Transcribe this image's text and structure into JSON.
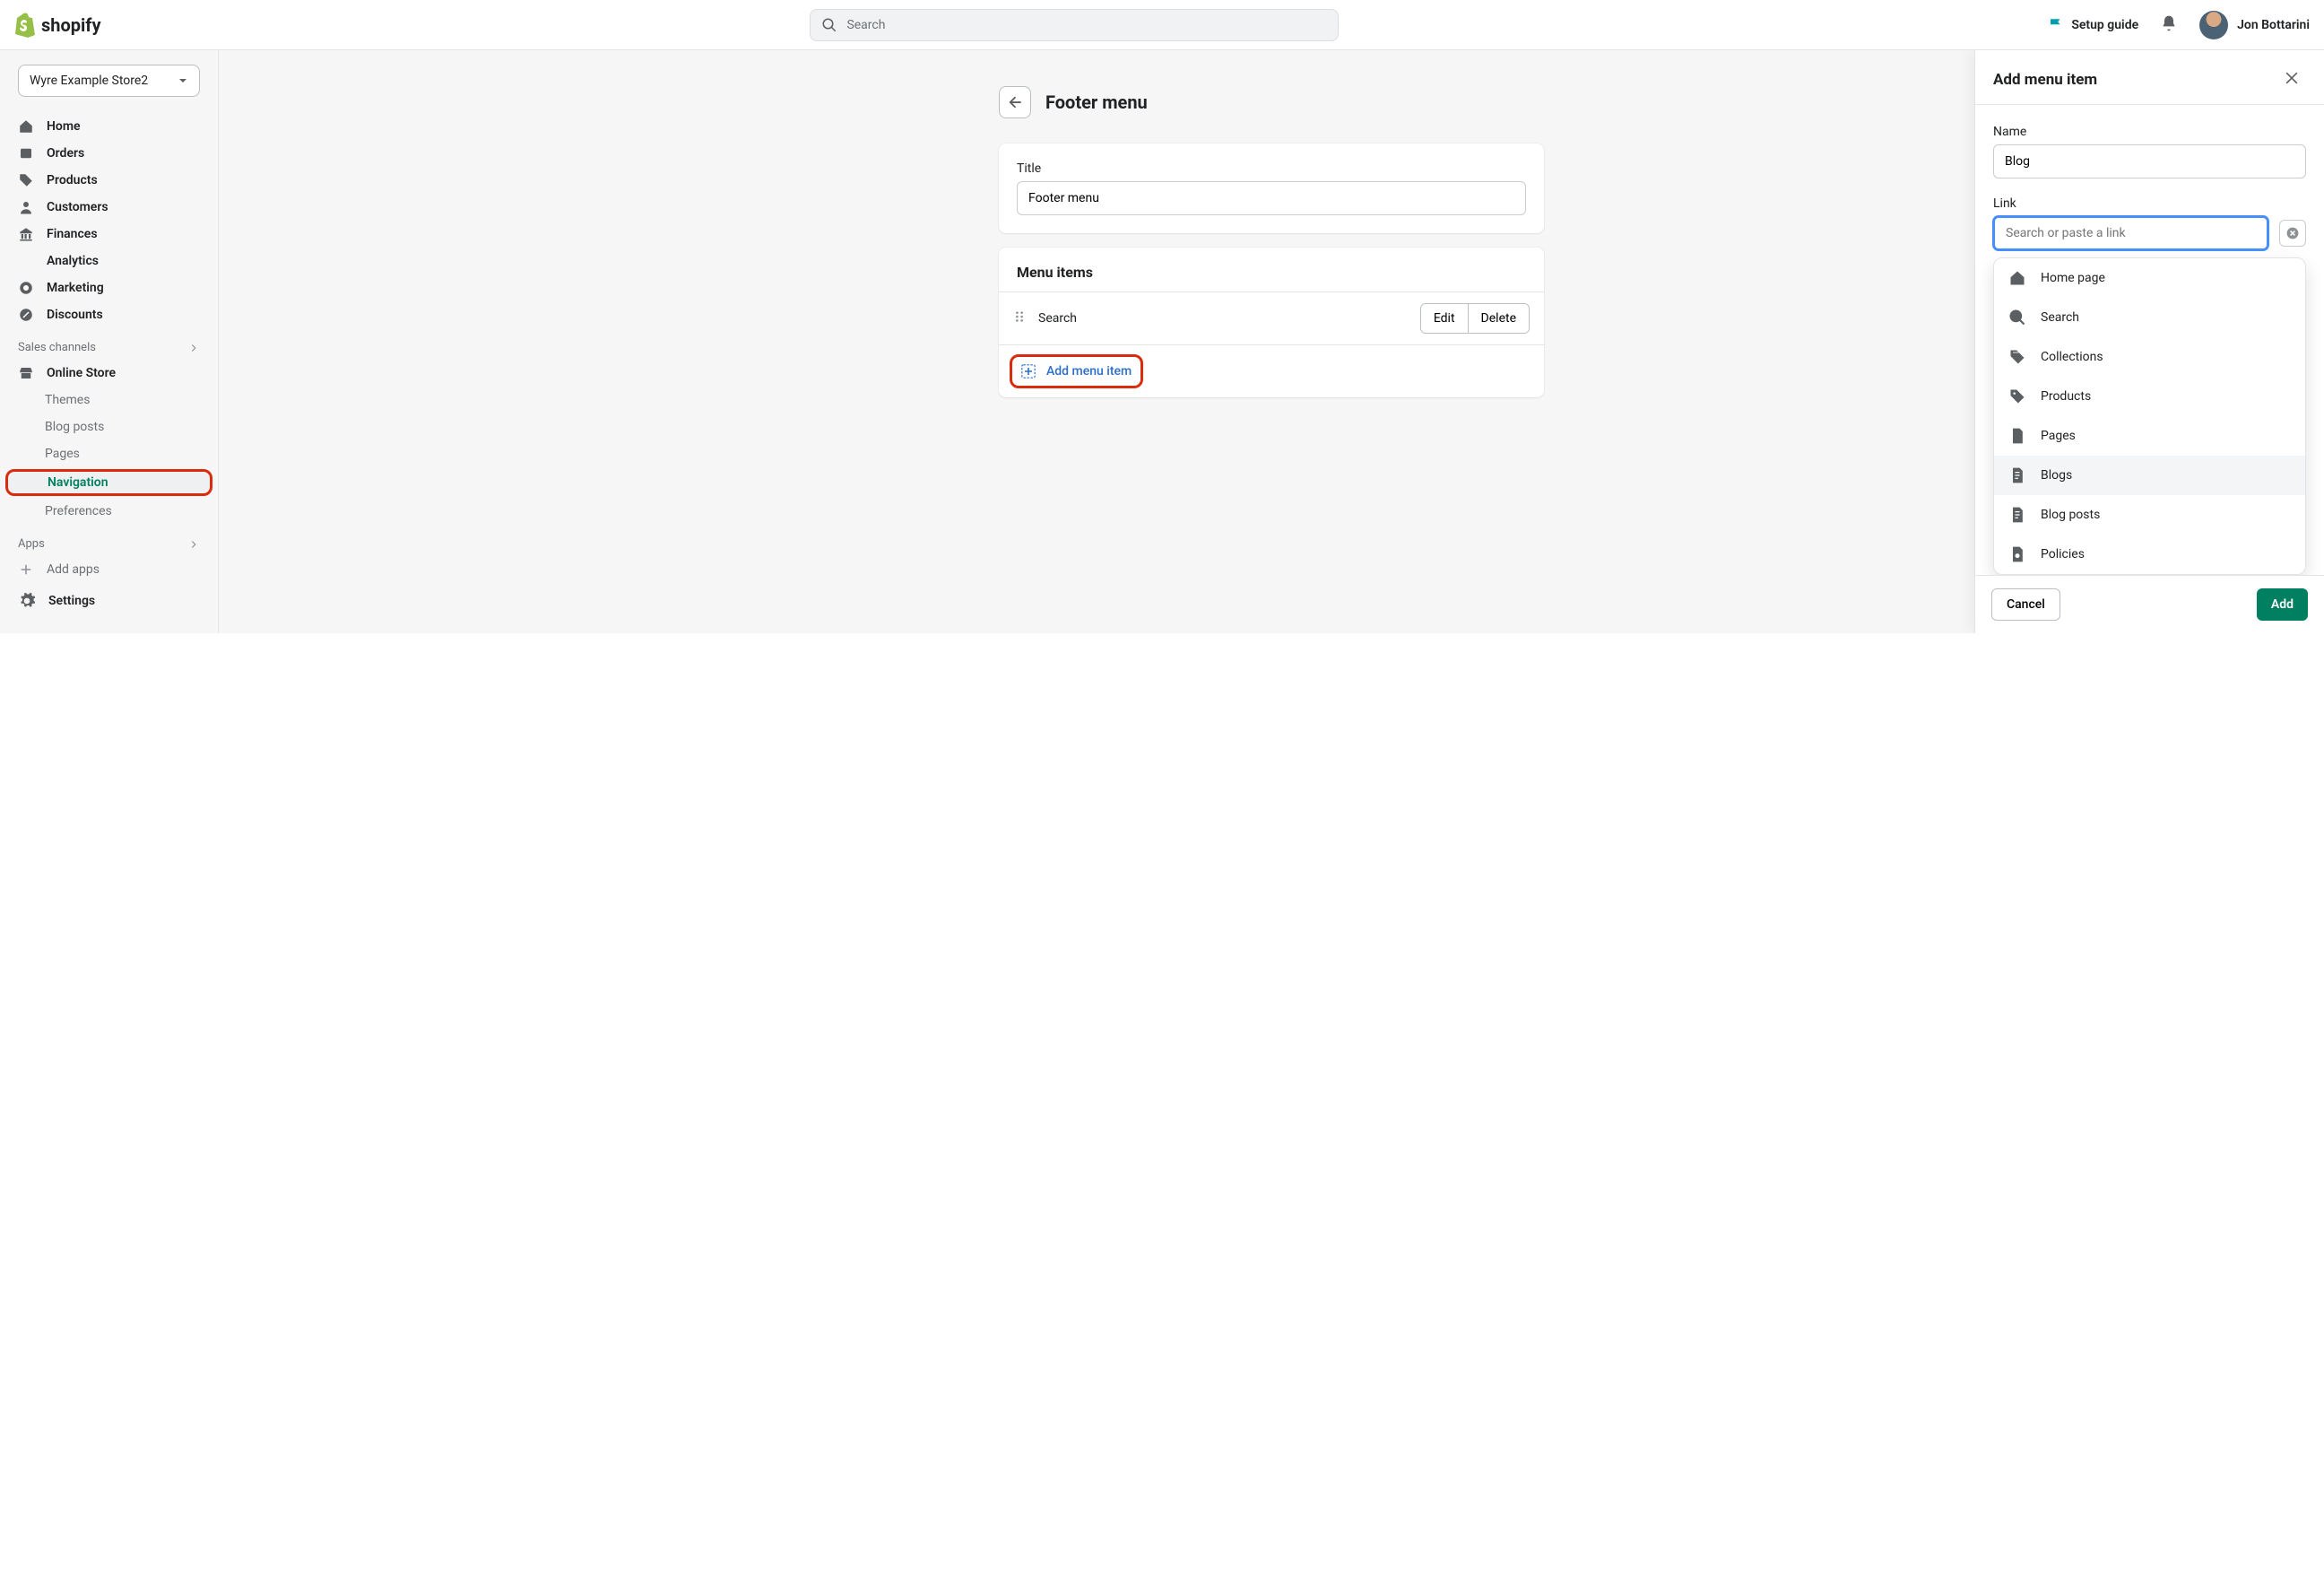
{
  "header": {
    "brand": "shopify",
    "search_placeholder": "Search",
    "setup_label": "Setup guide",
    "user_name": "Jon Bottarini"
  },
  "store_picker": "Wyre Example Store2",
  "sidebar": {
    "nav": {
      "home": "Home",
      "orders": "Orders",
      "products": "Products",
      "customers": "Customers",
      "finances": "Finances",
      "analytics": "Analytics",
      "marketing": "Marketing",
      "discounts": "Discounts"
    },
    "sales_channels_hd": "Sales channels",
    "online_store": "Online Store",
    "sub": {
      "themes": "Themes",
      "blog_posts": "Blog posts",
      "pages": "Pages",
      "navigation": "Navigation",
      "preferences": "Preferences"
    },
    "apps_hd": "Apps",
    "add_apps": "Add apps",
    "settings": "Settings"
  },
  "page": {
    "title": "Footer menu",
    "title_field_label": "Title",
    "title_value": "Footer menu",
    "menu_items_hd": "Menu items",
    "row_name": "Search",
    "edit": "Edit",
    "delete": "Delete",
    "add_menu_item": "Add menu item"
  },
  "panel": {
    "heading": "Add menu item",
    "name_label": "Name",
    "name_value": "Blog",
    "link_label": "Link",
    "link_placeholder": "Search or paste a link",
    "options": {
      "home": "Home page",
      "search": "Search",
      "collections": "Collections",
      "products": "Products",
      "pages": "Pages",
      "blogs": "Blogs",
      "blog_posts": "Blog posts",
      "policies": "Policies"
    },
    "cancel": "Cancel",
    "add": "Add"
  }
}
